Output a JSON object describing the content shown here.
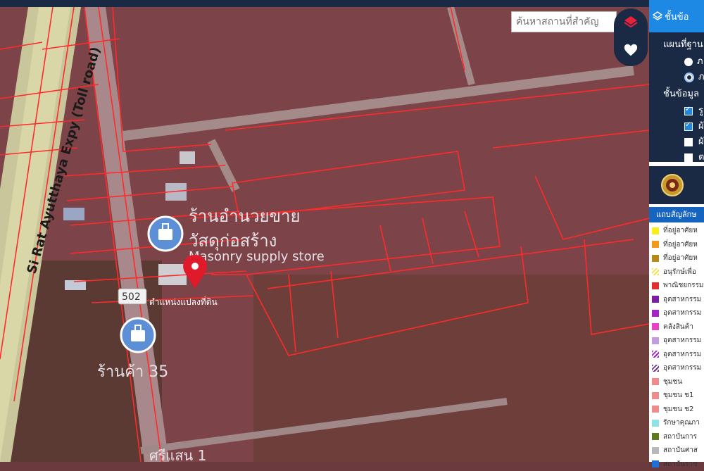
{
  "map": {
    "road_label": "Si Rat Ayutthaya Expy (Toll road)",
    "shield": "502",
    "poi1_line1": "ร้านอำนวยขาย",
    "poi1_line2": "วัสดุก่อสร้าง",
    "poi1_en": "Masonry supply store",
    "pin_label": "ตำแหน่งแปลงที่ดิน",
    "poi2": "ร้านค้า 35",
    "bottom_label": "ศรีแสน 1"
  },
  "search": {
    "placeholder": "ค้นหาสถานที่สำคัญ"
  },
  "panel": {
    "header": "ชั้นข้อ",
    "basemap_label": "แผนที่ฐาน",
    "radio1": "ภ",
    "radio2": "ภ",
    "layers_label": "ชั้นข้อมูล",
    "layers": [
      {
        "label": "รู",
        "checked": true
      },
      {
        "label": "ผั",
        "checked": true
      },
      {
        "label": "ผั",
        "checked": false
      },
      {
        "label": "ต",
        "checked": false
      }
    ],
    "legend_title": "แถบสัญลักษ",
    "legend": [
      {
        "label": "ที่อยู่อาศัยห",
        "color": "#f7ee1b"
      },
      {
        "label": "ที่อยู่อาศัยห",
        "color": "#f39a1c"
      },
      {
        "label": "ที่อยู่อาศัยห",
        "color": "#b58a1a"
      },
      {
        "label": "อนุรักษ์เพื่อ",
        "color": "#f5e24a"
      },
      {
        "label": "พาณิชยกรรม",
        "color": "#e52f2f"
      },
      {
        "label": "อุตสาหกรรม",
        "color": "#7a1fa2"
      },
      {
        "label": "อุตสาหกรรม",
        "color": "#a326c4"
      },
      {
        "label": "คลังสินค้า",
        "color": "#e940c9"
      },
      {
        "label": "อุตสาหกรรม",
        "color": "#c49be0"
      },
      {
        "label": "อุตสาหกรรม",
        "color": "#a326c4"
      },
      {
        "label": "อุตสาหกรรม",
        "color": "#6d3a8e"
      },
      {
        "label": "ชุมชน",
        "color": "#f28a8a"
      },
      {
        "label": "ชุมชน ช1",
        "color": "#ee8c8c"
      },
      {
        "label": "ชุมชน ช2",
        "color": "#ee8c8c"
      },
      {
        "label": "รักษาคุณภา",
        "color": "#8fe3e8"
      },
      {
        "label": "สถาบันการ",
        "color": "#5d7a1f"
      },
      {
        "label": "สถาบันศาส",
        "color": "#b8b8b8"
      },
      {
        "label": "สถาบันราช",
        "color": "#1e6fd8"
      }
    ]
  }
}
